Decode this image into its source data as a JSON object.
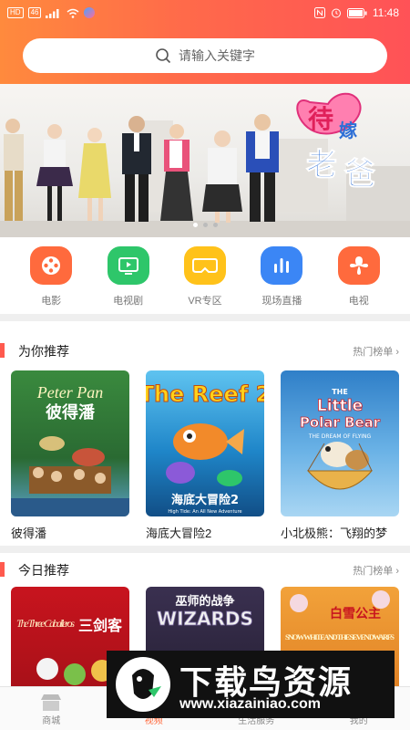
{
  "status_bar": {
    "left_chips": [
      "HD",
      "46"
    ],
    "time": "11:48"
  },
  "search": {
    "placeholder": "请输入关键字"
  },
  "banner": {
    "title_chars": [
      "待",
      "嫁",
      "老",
      "爸"
    ]
  },
  "categories": [
    {
      "label": "电影",
      "color": "#ff6a3d",
      "icon": "film-reel-icon"
    },
    {
      "label": "电视剧",
      "color": "#2ec66a",
      "icon": "tv-play-icon"
    },
    {
      "label": "VR专区",
      "color": "#ffc21a",
      "icon": "vr-headset-icon"
    },
    {
      "label": "现场直播",
      "color": "#3b86f5",
      "icon": "live-bars-icon"
    },
    {
      "label": "电视",
      "color": "#ff6a3d",
      "icon": "tv-grid-icon"
    }
  ],
  "sections": [
    {
      "title": "为你推荐",
      "more": "热门榜单",
      "items": [
        {
          "caption": "彼得潘",
          "poster_title": "Peter Pan",
          "poster_subtitle": "彼得潘",
          "bg": "#2f7a3a"
        },
        {
          "caption": "海底大冒险2",
          "poster_title": "The Reef 2",
          "poster_subtitle": "海底大冒险2",
          "poster_tagline": "High Tide: An All New Adventure",
          "bg": "#1f86c9"
        },
        {
          "caption": "小北极熊：飞翔的梦",
          "poster_title": "The Little Polar Bear",
          "poster_subtitle": "THE DREAM OF FLYING",
          "bg": "#4a9bd8"
        }
      ]
    },
    {
      "title": "今日推荐",
      "more": "热门榜单",
      "items": [
        {
          "caption": "",
          "poster_title": "The Three Caballeros",
          "poster_subtitle": "三剑客",
          "bg": "#b5121b"
        },
        {
          "caption": "",
          "poster_title": "WIZARDS",
          "poster_subtitle": "巫师的战争",
          "bg": "#2a2436"
        },
        {
          "caption": "",
          "poster_title": "SNOW WHITE AND THE SEVEN DWARFS",
          "poster_subtitle": "白雪公主",
          "bg": "#e08a2a"
        }
      ]
    }
  ],
  "bottom_nav": [
    {
      "label": "商城",
      "icon": "store-icon",
      "active": false
    },
    {
      "label": "视频",
      "icon": "video-icon",
      "active": true
    },
    {
      "label": "生活服务",
      "icon": "service-icon",
      "active": false
    },
    {
      "label": "我的",
      "icon": "user-icon",
      "active": false
    }
  ],
  "watermark": {
    "title": "下载鸟资源",
    "url": "www.xiazainiao.com"
  }
}
